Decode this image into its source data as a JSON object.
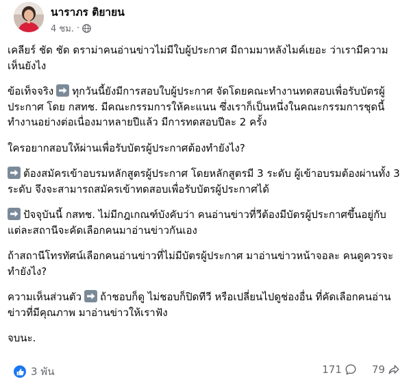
{
  "post": {
    "author": "นาราภร ติยายน",
    "time": "4 ชม.",
    "separator": "·",
    "privacy_icon": "globe-icon",
    "paragraphs": [
      {
        "prefix": "",
        "arrow": false,
        "text": "เคลียร์ ชัด ชัด ดราม่าคนอ่านข่าวไม่มีใบผู้ประกาศ  มีถามมาหลังไมค์เยอะ  ว่าเรามีความเห็นยังไง"
      },
      {
        "prefix": "ข้อเท็จจริง",
        "arrow": true,
        "text": "ทุกวันนี้ยังมีการสอบใบผู้ประกาศ  จัดโดยคณะทำงานทดสอบเพื่อรับบัตรผู้ประกาศ  โดย กสทช.   มีคณะกรรมการให้คะแนน  ซึ่งเราก็เป็นหนึ่งในคณะกรรมการชุดนี้   ทำงานอย่างต่อเนื่องมาหลายปีแล้ว   มีการทดสอบปีละ 2 ครั้ง"
      },
      {
        "prefix": "",
        "arrow": false,
        "text": "ใครอยากสอบให้ผ่านเพื่อรับบัตรผู้ประกาศต้องทำยังไง?"
      },
      {
        "prefix": "",
        "arrow": true,
        "text": "ต้องสมัครเข้าอบรมหลักสูตรผู้ประกาศ   โดยหลักสูตรมี 3 ระดับ ผู้เข้าอบรมต้องผ่านทั้ง 3 ระดับ   จึงจะสามารถสมัครเข้าทดสอบเพื่อรับบัตรผู้ประกาศได้"
      },
      {
        "prefix": "",
        "arrow": true,
        "text": "ปัจจุบันนี้ กสทช. ไม่มีกฎเกณฑ์บังคับว่า คนอ่านข่าวที่วีต้องมีบัตรผู้ประกาศขึ้นอยู่กับแต่ละสถานีจะคัดเลือกคนมาอ่านข่าวกันเอง"
      },
      {
        "prefix": "",
        "arrow": false,
        "text": "ถ้าสถานีโทรทัศน์เลือกคนอ่านข่าวที่ไม่มีบัตรผู้ประกาศ  มาอ่านข่าวหน้าจอละ คนดูควรจะทำยังไง?"
      },
      {
        "prefix": "ความเห็นส่วนตัว",
        "arrow": true,
        "text": "ถ้าชอบก็ดู  ไม่ชอบก็ปิดทีวี  หรือเปลี่ยนไปดูช่องอื่น ที่คัดเลือกคนอ่านข่าวที่มีคุณภาพ มาอ่านข่าวให้เราฟัง"
      },
      {
        "prefix": "",
        "arrow": false,
        "text": "จบนะ."
      }
    ],
    "reaction_count": "3 พัน",
    "comment_count": "171",
    "share_count": "79",
    "colors": {
      "like_blue": "#1877f2",
      "arrow_box": "#7b8a99",
      "meta_gray": "#65676b"
    }
  }
}
